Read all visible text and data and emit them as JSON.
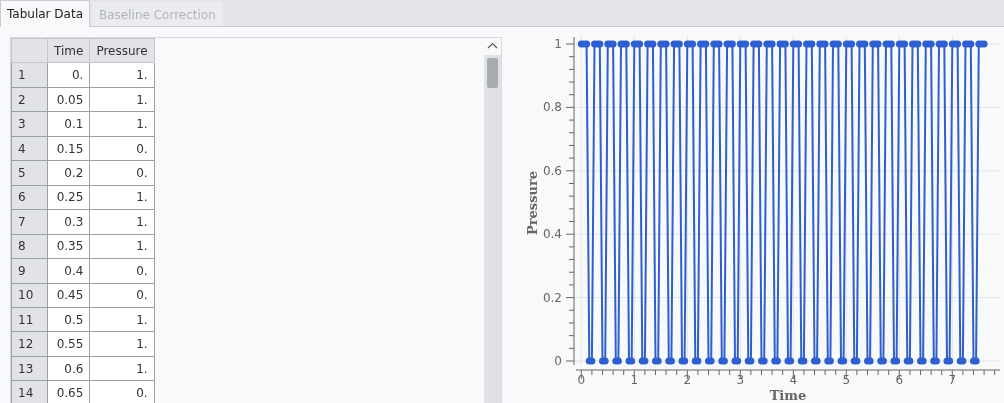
{
  "tabs": [
    {
      "label": "Tabular Data",
      "selected": true
    },
    {
      "label": "Baseline Correction",
      "selected": false
    }
  ],
  "table": {
    "columns": [
      "Time",
      "Pressure"
    ],
    "rows": [
      {
        "index": "1",
        "time": "0.",
        "pressure": "1."
      },
      {
        "index": "2",
        "time": "0.05",
        "pressure": "1."
      },
      {
        "index": "3",
        "time": "0.1",
        "pressure": "1."
      },
      {
        "index": "4",
        "time": "0.15",
        "pressure": "0."
      },
      {
        "index": "5",
        "time": "0.2",
        "pressure": "0."
      },
      {
        "index": "6",
        "time": "0.25",
        "pressure": "1."
      },
      {
        "index": "7",
        "time": "0.3",
        "pressure": "1."
      },
      {
        "index": "8",
        "time": "0.35",
        "pressure": "1."
      },
      {
        "index": "9",
        "time": "0.4",
        "pressure": "0."
      },
      {
        "index": "10",
        "time": "0.45",
        "pressure": "0."
      },
      {
        "index": "11",
        "time": "0.5",
        "pressure": "1."
      },
      {
        "index": "12",
        "time": "0.55",
        "pressure": "1."
      },
      {
        "index": "13",
        "time": "0.6",
        "pressure": "1."
      },
      {
        "index": "14",
        "time": "0.65",
        "pressure": "0."
      }
    ]
  },
  "plot": {
    "chart_data": {
      "type": "line",
      "xlabel": "Time",
      "ylabel": "Pressure",
      "x": [
        0,
        0.05,
        0.1,
        0.15,
        0.2,
        0.25,
        0.3,
        0.35,
        0.4,
        0.45,
        0.5,
        0.55,
        0.6,
        0.65,
        0.7,
        0.75,
        0.8,
        0.85,
        0.9,
        0.95,
        1,
        1.05,
        1.1,
        1.15,
        1.2,
        1.25,
        1.3,
        1.35,
        1.4,
        1.45,
        1.5,
        1.55,
        1.6,
        1.65,
        1.7,
        1.75,
        1.8,
        1.85,
        1.9,
        1.95,
        2,
        2.05,
        2.1,
        2.15,
        2.2,
        2.25,
        2.3,
        2.35,
        2.4,
        2.45,
        2.5,
        2.55,
        2.6,
        2.65,
        2.7,
        2.75,
        2.8,
        2.85,
        2.9,
        2.95,
        3,
        3.05,
        3.1,
        3.15,
        3.2,
        3.25,
        3.3,
        3.35,
        3.4,
        3.45,
        3.5,
        3.55,
        3.6,
        3.65,
        3.7,
        3.75,
        3.8,
        3.85,
        3.9,
        3.95,
        4,
        4.05,
        4.1,
        4.15,
        4.2,
        4.25,
        4.3,
        4.35,
        4.4,
        4.45,
        4.5,
        4.55,
        4.6,
        4.65,
        4.7,
        4.75,
        4.8,
        4.85,
        4.9,
        4.95,
        5,
        5.05,
        5.1,
        5.15,
        5.2,
        5.25,
        5.3,
        5.35,
        5.4,
        5.45,
        5.5,
        5.55,
        5.6,
        5.65,
        5.7,
        5.75,
        5.8,
        5.85,
        5.9,
        5.95,
        6,
        6.05,
        6.1,
        6.15,
        6.2,
        6.25,
        6.3,
        6.35,
        6.4,
        6.45,
        6.5,
        6.55,
        6.6,
        6.65,
        6.7,
        6.75,
        6.8,
        6.85,
        6.9,
        6.95,
        7,
        7.05,
        7.1,
        7.15,
        7.2,
        7.25,
        7.3,
        7.35,
        7.4,
        7.45,
        7.5,
        7.55,
        7.6
      ],
      "series": [
        {
          "color": "#2f5fcf",
          "marker": "circle",
          "values": [
            1,
            1,
            1,
            0,
            0,
            1,
            1,
            1,
            0,
            0,
            1,
            1,
            1,
            0,
            0,
            1,
            1,
            1,
            0,
            0,
            1,
            1,
            1,
            0,
            0,
            1,
            1,
            1,
            0,
            0,
            1,
            1,
            1,
            0,
            0,
            1,
            1,
            1,
            0,
            0,
            1,
            1,
            1,
            0,
            0,
            1,
            1,
            1,
            0,
            0,
            1,
            1,
            1,
            0,
            0,
            1,
            1,
            1,
            0,
            0,
            1,
            1,
            1,
            0,
            0,
            1,
            1,
            1,
            0,
            0,
            1,
            1,
            1,
            0,
            0,
            1,
            1,
            1,
            0,
            0,
            1,
            1,
            1,
            0,
            0,
            1,
            1,
            1,
            0,
            0,
            1,
            1,
            1,
            0,
            0,
            1,
            1,
            1,
            0,
            0,
            1,
            1,
            1,
            0,
            0,
            1,
            1,
            1,
            0,
            0,
            1,
            1,
            1,
            0,
            0,
            1,
            1,
            1,
            0,
            0,
            1,
            1,
            1,
            0,
            0,
            1,
            1,
            1,
            0,
            0,
            1,
            1,
            1,
            0,
            0,
            1,
            1,
            1,
            0,
            0,
            1,
            1,
            1,
            0,
            0,
            1,
            1,
            1,
            0,
            0,
            1,
            1,
            1
          ]
        }
      ],
      "grid": true,
      "xlim": [
        -0.1,
        7.9
      ],
      "ylim": [
        0,
        1
      ],
      "xticks": [
        0,
        1,
        2,
        3,
        4,
        5,
        6,
        7
      ],
      "yticks": [
        0,
        0.2,
        0.4,
        0.6,
        0.8,
        1
      ]
    }
  }
}
